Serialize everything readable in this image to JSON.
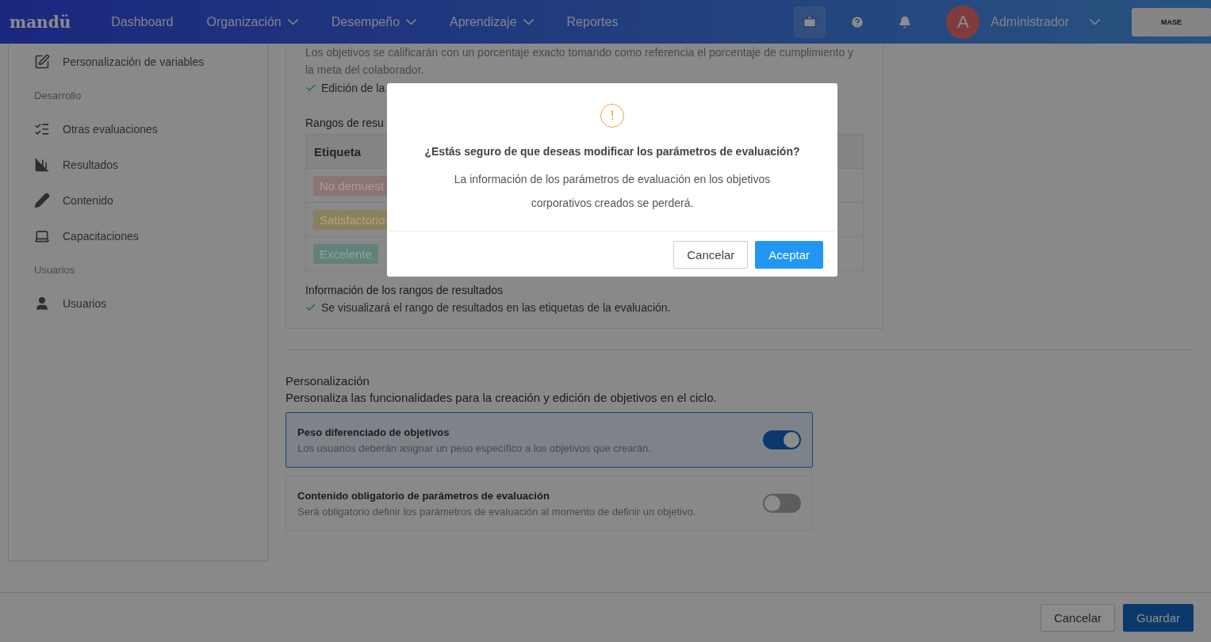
{
  "header": {
    "logo": "mandü",
    "nav": [
      {
        "label": "Dashboard",
        "dropdown": false
      },
      {
        "label": "Organización",
        "dropdown": true
      },
      {
        "label": "Desempeño",
        "dropdown": true
      },
      {
        "label": "Aprendizaje",
        "dropdown": true
      },
      {
        "label": "Reportes",
        "dropdown": false
      }
    ],
    "user": {
      "initial": "A",
      "name": "Administrador"
    },
    "company": "MASE"
  },
  "sidebar": {
    "items": [
      {
        "kind": "link",
        "label": "Personalización de variables"
      },
      {
        "kind": "section",
        "label": "Desarrollo"
      },
      {
        "kind": "link",
        "label": "Otras evaluaciones"
      },
      {
        "kind": "link",
        "label": "Resultados"
      },
      {
        "kind": "link",
        "label": "Contenido"
      },
      {
        "kind": "link",
        "label": "Capacitaciones"
      },
      {
        "kind": "section",
        "label": "Usuarios"
      },
      {
        "kind": "link",
        "label": "Usuarios"
      }
    ]
  },
  "evaluation": {
    "description": "Los objetivos se calificarán con un porcentaje exacto tomando como referencia el porcentaje de cumplimiento y la meta del colaborador.",
    "check": "Edición de la",
    "ranges_title": "Rangos de resu",
    "table_header": "Etiqueta",
    "tags": [
      {
        "label": "No demuest",
        "color": "#8a7474"
      },
      {
        "label": "Satisfactorio",
        "color": "#8a805e"
      },
      {
        "label": "Excelente",
        "color": "#63817b"
      }
    ],
    "info_title": "Información de los rangos de resultados",
    "info_check": "Se visualizará el rango de resultados en las etiquetas de la evaluación."
  },
  "personalization": {
    "title": "Personalización",
    "description": "Personaliza las funcionalidades para la creación y edición de objetivos en el ciclo.",
    "options": [
      {
        "title": "Peso diferenciado de objetivos",
        "description": "Los usuarios deberán asignar un peso específico a los objetivos que crearán.",
        "on": true
      },
      {
        "title": "Contenido obligatorio de parámetros de evaluación",
        "description": "Será obligatorio definir los parámetros de evaluación al momento de definir un objetivo.",
        "on": false
      }
    ]
  },
  "footer": {
    "cancel": "Cancelar",
    "save": "Guardar"
  },
  "modal": {
    "icon": "!",
    "title": "¿Estás seguro de que deseas modificar los parámetros de evaluación?",
    "message": "La información de los parámetros de evaluación en los objetivos corporativos creados se perderá.",
    "cancel": "Cancelar",
    "accept": "Aceptar"
  }
}
